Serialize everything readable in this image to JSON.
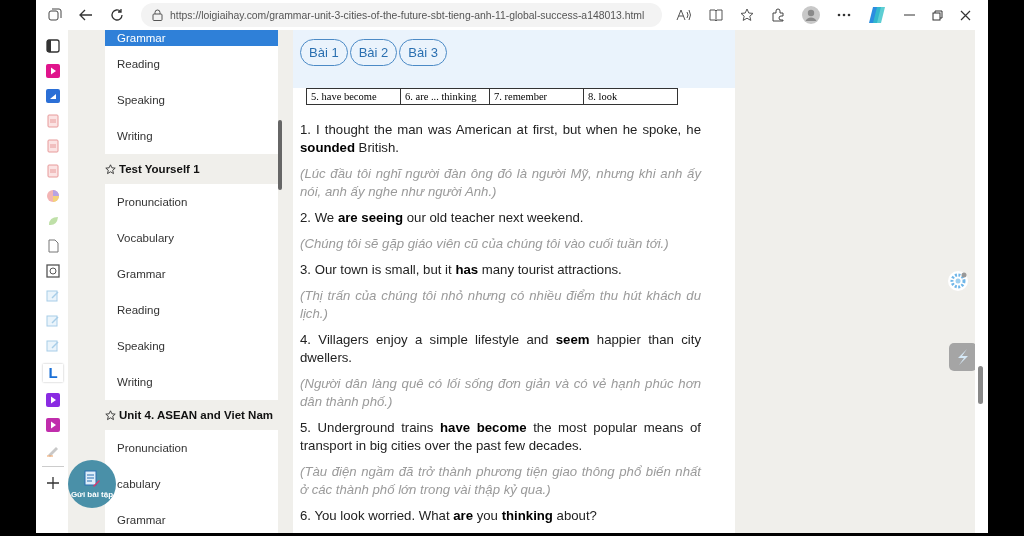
{
  "browser": {
    "url": "https://loigiaihay.com/grammar-unit-3-cities-of-the-future-sbt-tieng-anh-11-global-success-a148013.html"
  },
  "edge_sidebar": {
    "app_letter": "L"
  },
  "nav_menu": {
    "items": [
      {
        "kind": "item",
        "label": "Grammar",
        "selected": true
      },
      {
        "kind": "item",
        "label": "Reading",
        "selected": false
      },
      {
        "kind": "item",
        "label": "Speaking",
        "selected": false
      },
      {
        "kind": "item",
        "label": "Writing",
        "selected": false
      },
      {
        "kind": "heading",
        "label": "Test Yourself 1",
        "selected": false
      },
      {
        "kind": "item",
        "label": "Pronunciation",
        "selected": false
      },
      {
        "kind": "item",
        "label": "Vocabulary",
        "selected": false
      },
      {
        "kind": "item",
        "label": "Grammar",
        "selected": false
      },
      {
        "kind": "item",
        "label": "Reading",
        "selected": false
      },
      {
        "kind": "item",
        "label": "Speaking",
        "selected": false
      },
      {
        "kind": "item",
        "label": "Writing",
        "selected": false
      },
      {
        "kind": "heading",
        "label": "Unit 4. ASEAN and Viet Nam",
        "selected": false
      },
      {
        "kind": "item",
        "label": "Pronunciation",
        "selected": false
      },
      {
        "kind": "item",
        "label": "cabulary",
        "selected": false
      },
      {
        "kind": "item",
        "label": "Grammar",
        "selected": false
      }
    ]
  },
  "submit_button": {
    "label": "Gửi bài tập"
  },
  "lesson_tabs": [
    {
      "label": "Bài 1",
      "selected": false
    },
    {
      "label": "Bài 2",
      "selected": false
    },
    {
      "label": "Bài 3",
      "selected": false
    }
  ],
  "answer_table": {
    "cells": [
      "5. have become",
      "6. are ... thinking",
      "7. remember",
      "8. look"
    ]
  },
  "exercises": [
    {
      "sentence": "1. I thought the man was American at first, but when he spoke, he **sounded** British.",
      "translation": "(Lúc đầu tôi nghĩ người đàn ông đó là người Mỹ, nhưng khi anh ấy nói, anh ấy nghe như người Anh.)"
    },
    {
      "sentence": "2. We **are seeing** our old teacher next weekend.",
      "translation": "(Chúng tôi sẽ gặp giáo viên cũ của chúng tôi vào cuối tuần tới.)"
    },
    {
      "sentence": "3. Our town is small, but it **has** many tourist attractions.",
      "translation": "(Thị trấn của chúng tôi nhỏ nhưng có nhiều điểm thu hút khách du lịch.)"
    },
    {
      "sentence": "4. Villagers enjoy a simple lifestyle and **seem** happier than city dwellers.",
      "translation": "(Người dân làng quê có lối sống đơn giản và có vẻ hạnh phúc hơn dân thành phố.)"
    },
    {
      "sentence": "5. Underground trains **have become** the most popular means of transport in big cities over the past few decades.",
      "translation": "(Tàu điện ngầm đã trở thành phương tiện giao thông phổ biến nhất ở các thành phố lớn trong vài thập kỷ qua.)"
    },
    {
      "sentence": "6. You look worried. What **are** you **thinking** about?"
    }
  ]
}
